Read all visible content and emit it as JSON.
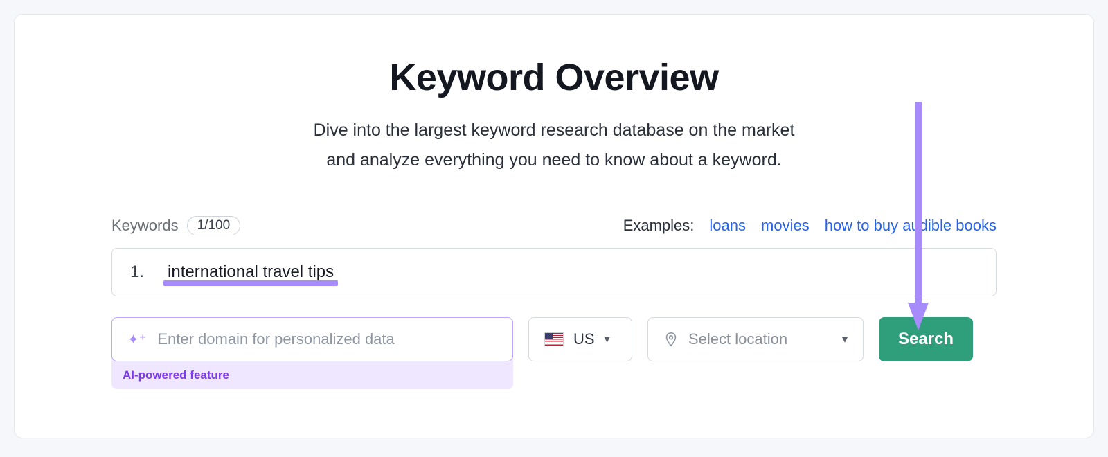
{
  "header": {
    "title": "Keyword Overview",
    "subtitle_line1": "Dive into the largest keyword research database on the market",
    "subtitle_line2": "and analyze everything you need to know about a keyword."
  },
  "keywords": {
    "label": "Keywords",
    "counter": "1/100",
    "row_number": "1.",
    "value": "international travel tips"
  },
  "examples": {
    "label": "Examples:",
    "items": [
      "loans",
      "movies",
      "how to buy audible books"
    ]
  },
  "domain_input": {
    "placeholder": "Enter domain for personalized data",
    "ai_label": "AI-powered feature"
  },
  "country_select": {
    "value": "US"
  },
  "location_select": {
    "placeholder": "Select location"
  },
  "search_button": {
    "label": "Search"
  }
}
